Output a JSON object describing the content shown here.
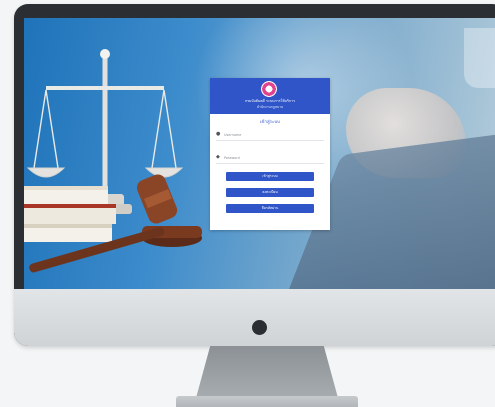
{
  "login": {
    "org_name": "กรมบังคับคดี ระบบการให้บริการ",
    "org_sub": "สำนักงานกฎหมาย",
    "title": "เข้าสู่ระบบ",
    "username_placeholder": "Username",
    "password_placeholder": "Password",
    "buttons": [
      "เข้าสู่ระบบ",
      "ลงทะเบียน",
      "ลืมรหัสผ่าน"
    ]
  },
  "colors": {
    "accent": "#2f55c8",
    "seal": "#e0448e",
    "monitor_bezel": "#2b2f33"
  },
  "icons": {
    "username": "user-icon",
    "password": "lock-icon"
  }
}
